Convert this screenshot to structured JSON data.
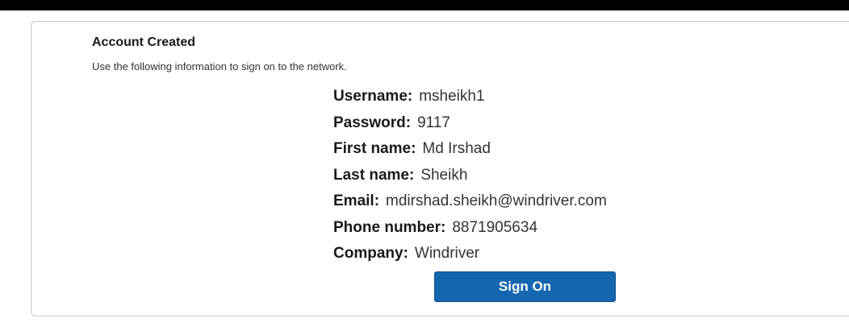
{
  "header": {
    "title": "Account Created",
    "subtitle": "Use the following information to sign on to the network."
  },
  "account": {
    "fields": [
      {
        "label": "Username:",
        "value": "msheikh1"
      },
      {
        "label": "Password:",
        "value": "9117"
      },
      {
        "label": "First name:",
        "value": "Md Irshad"
      },
      {
        "label": "Last name:",
        "value": "Sheikh"
      },
      {
        "label": "Email:",
        "value": "mdirshad.sheikh@windriver.com"
      },
      {
        "label": "Phone number:",
        "value": "8871905634"
      },
      {
        "label": "Company:",
        "value": "Windriver"
      }
    ]
  },
  "actions": {
    "sign_on_label": "Sign On"
  },
  "colors": {
    "button": "#1466b0",
    "top_bar": "#000000"
  }
}
